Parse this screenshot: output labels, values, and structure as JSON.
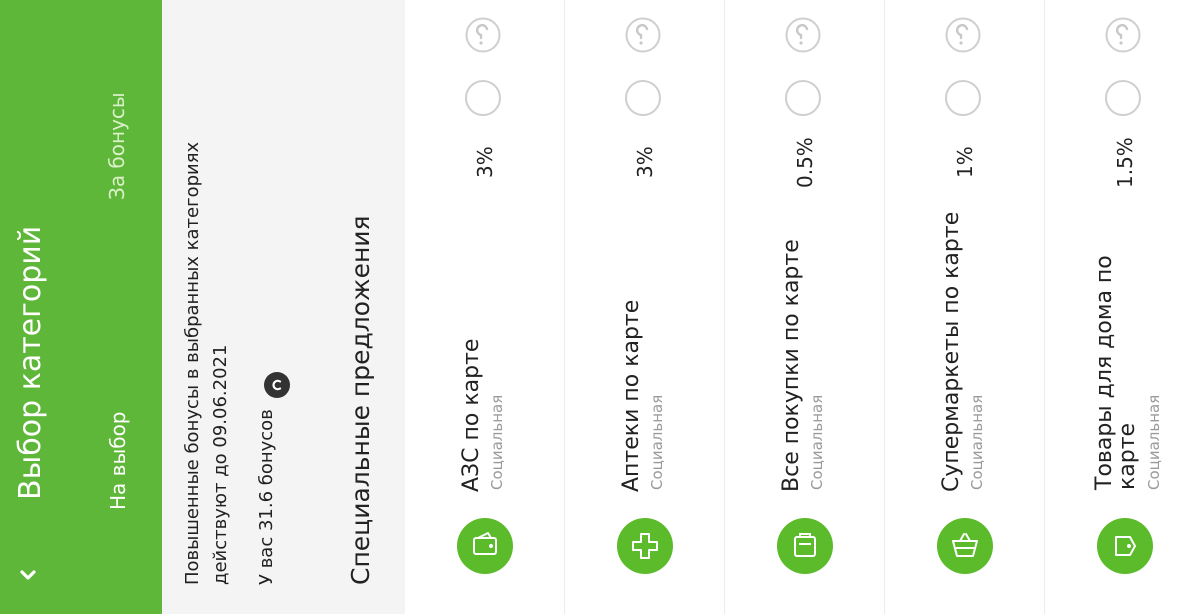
{
  "header": {
    "back_icon": "chevron-left-icon",
    "title": "Выбор категорий",
    "tabs": [
      {
        "label": "На выбор"
      },
      {
        "label": "За бонусы"
      }
    ]
  },
  "info": {
    "line1": "Повышенные бонусы в выбранных категориях",
    "line2": "действуют до 09.06.2021",
    "balance": "У вас 31.6 бонусов",
    "special_title": "Специальные предложения"
  },
  "colors": {
    "accent": "#5fb73a",
    "icon_bg": "#5cbb2b"
  },
  "categories": [
    {
      "name": "АЗС по карте",
      "type": "Социальная",
      "percent": "3%",
      "icon": "fuel-wallet-icon"
    },
    {
      "name": "Аптеки по карте",
      "type": "Социальная",
      "percent": "3%",
      "icon": "pharmacy-cross-icon"
    },
    {
      "name": "Все покупки по карте",
      "type": "Социальная",
      "percent": "0.5%",
      "icon": "purchases-icon"
    },
    {
      "name": "Супермаркеты по карте",
      "type": "Социальная",
      "percent": "1%",
      "icon": "basket-icon"
    },
    {
      "name": "Товары для дома по карте",
      "type": "Социальная",
      "percent": "1.5%",
      "icon": "home-goods-icon"
    }
  ]
}
